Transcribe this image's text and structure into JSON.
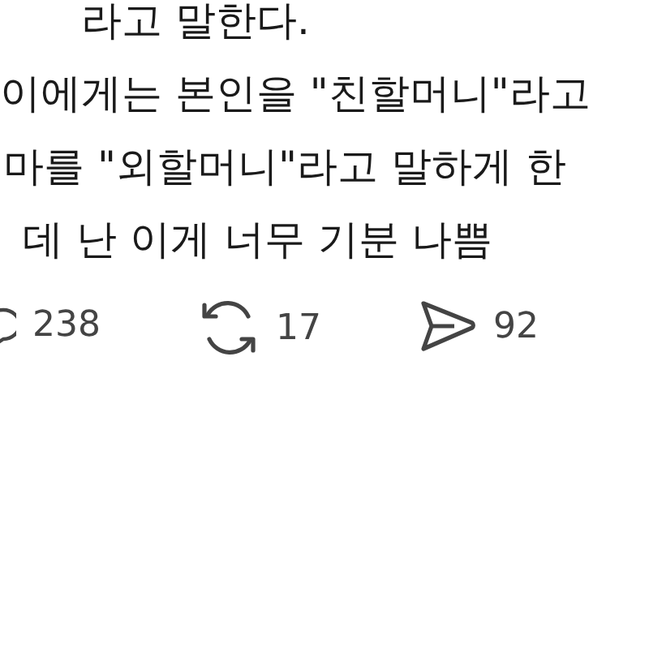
{
  "post": {
    "lines": [
      "라고 말한다.",
      "이에게는 본인을 \"친할머니\"라고",
      "마를 \"외할머니\"라고 말하게 한",
      "데 난 이게 너무 기분 나쁨"
    ]
  },
  "actions": [
    {
      "kind": "comment",
      "count": "238"
    },
    {
      "kind": "repost",
      "count": "17"
    },
    {
      "kind": "share",
      "count": "92"
    }
  ]
}
